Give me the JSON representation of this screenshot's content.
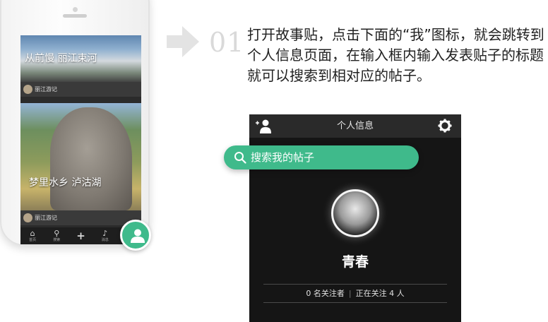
{
  "feed": {
    "cards": [
      {
        "title": "从前慢 丽江束河",
        "author": "丽江游记"
      },
      {
        "title": "梦里水乡 泸沽湖",
        "author": "丽江游记"
      }
    ]
  },
  "tabbar": {
    "items": [
      {
        "label": "首页"
      },
      {
        "label": "搜索"
      },
      {
        "label": ""
      },
      {
        "label": "消息"
      },
      {
        "label": ""
      }
    ]
  },
  "step": {
    "number": "01",
    "instruction": "打开故事贴，点击下面的“我”图标，就会跳转到个人信息页面，在输入框内输入发表贴子的标题就可以搜索到相对应的帖子。"
  },
  "profile": {
    "title": "个人信息",
    "username": "青春",
    "followers": "0 名关注者",
    "following": "正在关注 4 人"
  },
  "search": {
    "placeholder": "搜索我的帖子"
  },
  "colors": {
    "accent": "#3fba8b",
    "panel_bg": "#151515",
    "header_bg": "#2a2a2a"
  }
}
